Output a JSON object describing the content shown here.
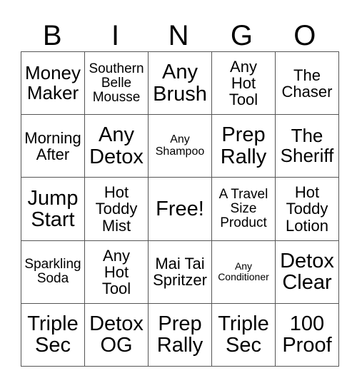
{
  "header": [
    "B",
    "I",
    "N",
    "G",
    "O"
  ],
  "rows": [
    [
      "Money\nMaker",
      "Southern\nBelle\nMousse",
      "Any\nBrush",
      "Any\nHot\nTool",
      "The\nChaser"
    ],
    [
      "Morning\nAfter",
      "Any\nDetox",
      "Any\nShampoo",
      "Prep\nRally",
      "The\nSheriff"
    ],
    [
      "Jump\nStart",
      "Hot\nToddy\nMist",
      "Free!",
      "A Travel\nSize\nProduct",
      "Hot\nToddy\nLotion"
    ],
    [
      "Sparkling\nSoda",
      "Any\nHot\nTool",
      "Mai Tai\nSpritzer",
      "Any\nConditioner",
      "Detox\nClear"
    ],
    [
      "Triple\nSec",
      "Detox\nOG",
      "Prep\nRally",
      "Triple\nSec",
      "100\nProof"
    ]
  ]
}
